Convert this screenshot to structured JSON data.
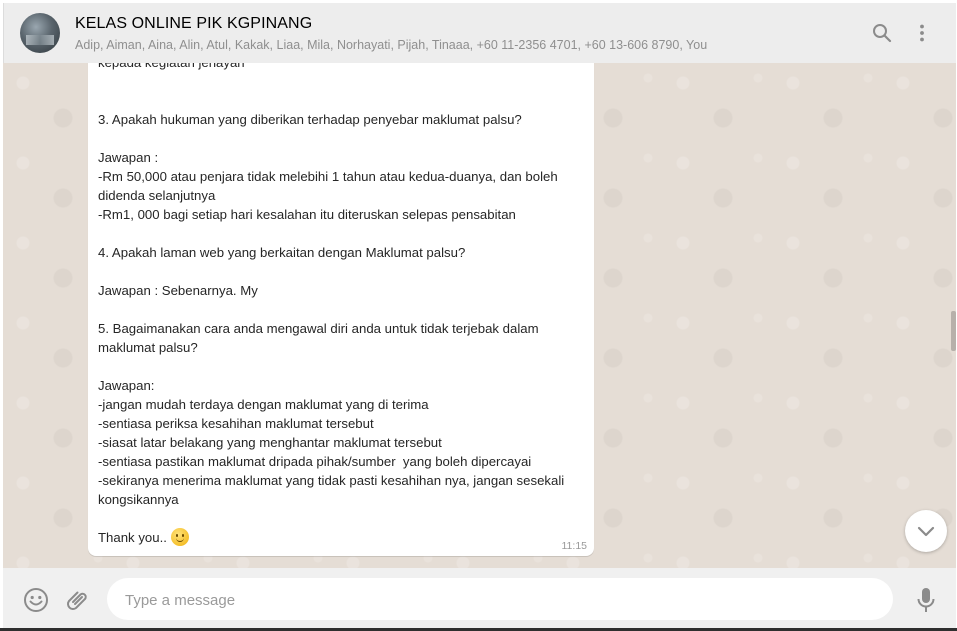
{
  "header": {
    "title": "KELAS ONLINE PIK KGPINANG",
    "participants": "Adip, Aiman, Aina, Alin, Atul, Kakak, Liaa, Mila, Norhayati, Pijah, Tinaaa, +60 11-2356 4701, +60 13-606 8790, You",
    "icons": [
      "search-icon",
      "more-vert-icon"
    ]
  },
  "message": {
    "text": "kepada kegiatan jenayah\n\n\n3. Apakah hukuman yang diberikan terhadap penyebar maklumat palsu?\n\nJawapan :\n-Rm 50,000 atau penjara tidak melebihi 1 tahun atau kedua-duanya, dan boleh didenda selanjutnya\n-Rm1, 000 bagi setiap hari kesalahan itu diteruskan selepas pensabitan\n\n4. Apakah laman web yang berkaitan dengan Maklumat palsu?\n\nJawapan : Sebenarnya. My\n\n5. Bagaimanakan cara anda mengawal diri anda untuk tidak terjebak dalam maklumat palsu?\n\nJawapan:\n-jangan mudah terdaya dengan maklumat yang di terima\n-sentiasa periksa kesahihan maklumat tersebut\n-siasat latar belakang yang menghantar maklumat tersebut\n-sentiasa pastikan maklumat dripada pihak/sumber  yang boleh dipercayai\n-sekiranya menerima maklumat yang tidak pasti kesahihan nya, jangan sesekali kongsikannya\n\n",
    "closing": "Thank you.. ",
    "emoji": "slightly-smiling-face-icon",
    "time": "11:15"
  },
  "footer": {
    "placeholder": "Type a message",
    "icons": [
      "emoji-icon",
      "attach-icon",
      "mic-icon"
    ]
  },
  "colors": {
    "header_bg": "#ededed",
    "chat_bg": "#e5ddd5",
    "bubble_bg": "#ffffff",
    "footer_bg": "#f0f0f0"
  }
}
